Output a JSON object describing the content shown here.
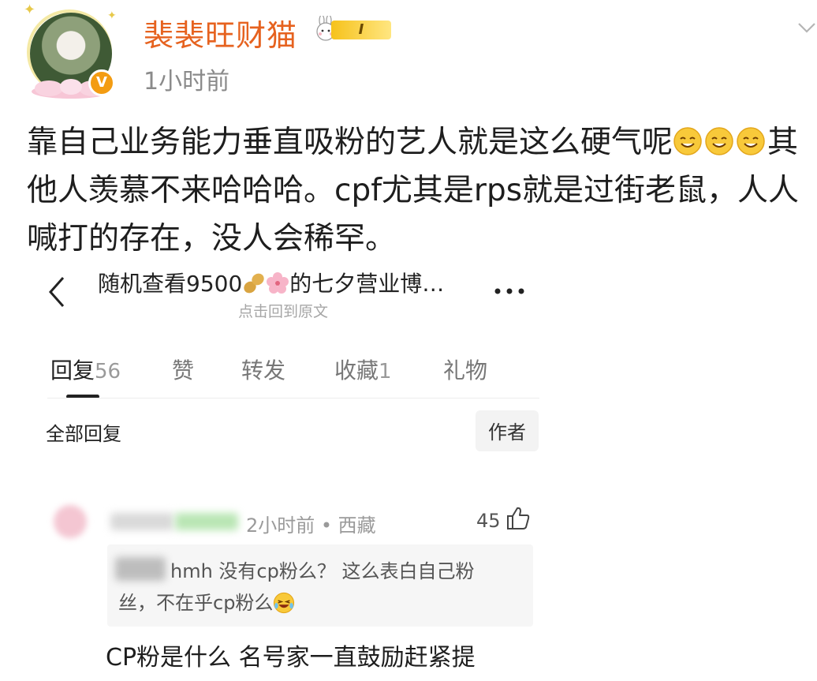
{
  "header": {
    "username": "裴裴旺财猫",
    "level_badge": "I",
    "time": "1小时前",
    "verified_badge": "V"
  },
  "post": {
    "line1": "靠自己业务能力垂直吸粉的艺人就是这么硬气呢",
    "line1_tail": "其",
    "line2": "他人羡慕不来哈哈哈。cpf尤其是rps就是过街老鼠，人人",
    "line3": "喊打的存在，没人会稀罕。"
  },
  "embedded": {
    "title_prefix": "随机查看9500",
    "title_suffix": "的七夕营业博…",
    "subtitle": "点击回到原文",
    "tabs": [
      {
        "label": "回复",
        "count": "56"
      },
      {
        "label": "赞",
        "count": ""
      },
      {
        "label": "转发",
        "count": ""
      },
      {
        "label": "收藏",
        "count": "1"
      },
      {
        "label": "礼物",
        "count": ""
      }
    ],
    "all_replies": "全部回复",
    "author_filter": "作者",
    "comment": {
      "meta": "2小时前 • 西藏",
      "likes": "45",
      "quote_line1": "hmh 没有cp粉么？ 这么表白自己粉",
      "quote_line2": "丝，不在乎cp粉么",
      "reply": "CP粉是什么 名号家一直鼓励赶紧提"
    }
  },
  "colors": {
    "username": "#e6621f",
    "muted": "#8a8a8a",
    "badge_gold": "#f6c21c"
  }
}
